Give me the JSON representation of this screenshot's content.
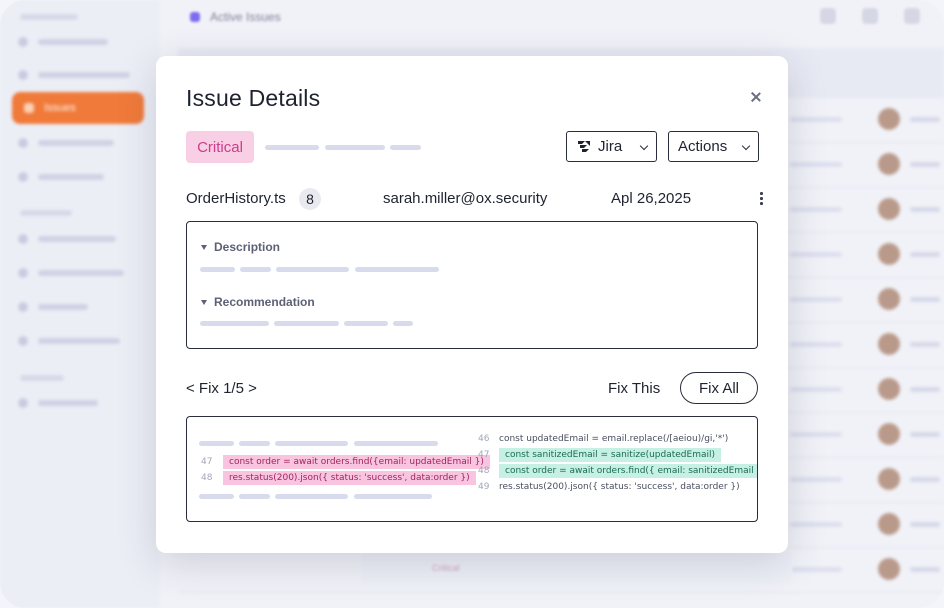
{
  "background": {
    "header_title": "Active Issues",
    "sidebar_active": "Issues",
    "row_severity": "Critical"
  },
  "modal": {
    "title": "Issue Details",
    "severity": "Critical",
    "integration": "Jira",
    "actions_label": "Actions",
    "file_name": "OrderHistory.ts",
    "file_count": "8",
    "user_email": "sarah.miller@ox.security",
    "date": "Apl 26,2025",
    "sections": {
      "description": "Description",
      "recommendation": "Recommendation"
    },
    "fix_nav": "< Fix 1/5 >",
    "fix_this": "Fix This",
    "fix_all": "Fix All",
    "code": {
      "left": [
        {
          "num": "47",
          "text": "const order = await orders.find({email: updatedEmail })"
        },
        {
          "num": "48",
          "text": "res.status(200).json({ status: 'success', data:order })"
        }
      ],
      "right": [
        {
          "num": "46",
          "text": "const updatedEmail = email.replace(/[aeiou)/gi,'*')"
        },
        {
          "num": "47",
          "text": "const sanitizedEmail = sanitize(updatedEmail)"
        },
        {
          "num": "48",
          "text": "const order = await orders.find({ email: sanitizedEmail })"
        },
        {
          "num": "49",
          "text": "res.status(200).json({ status: 'success', data:order })"
        }
      ]
    }
  },
  "colors": {
    "severity_bg": "#f8cfe4",
    "severity_fg": "#cf3b8c",
    "accent_orange": "#f07a3a",
    "removed_bg": "#f9c4df",
    "added_bg": "#c5f0e3"
  }
}
